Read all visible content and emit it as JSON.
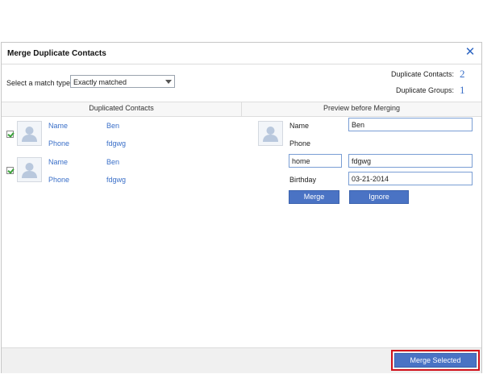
{
  "dialog": {
    "title": "Merge Duplicate Contacts",
    "close_icon": "close-icon"
  },
  "match": {
    "label": "Select a match type:",
    "selected": "Exactly matched"
  },
  "stats": {
    "duplicate_contacts_label": "Duplicate Contacts:",
    "duplicate_contacts_value": "2",
    "duplicate_groups_label": "Duplicate Groups:",
    "duplicate_groups_value": "1"
  },
  "columns": {
    "left": "Duplicated Contacts",
    "right": "Preview before Merging"
  },
  "contacts": [
    {
      "checked": true,
      "name_label": "Name",
      "name_value": "Ben",
      "phone_label": "Phone",
      "phone_value": "fdgwg"
    },
    {
      "checked": true,
      "name_label": "Name",
      "name_value": "Ben",
      "phone_label": "Phone",
      "phone_value": "fdgwg"
    }
  ],
  "preview": {
    "name_label": "Name",
    "name_value": "Ben",
    "phone_label": "Phone",
    "phone_type": "home",
    "phone_value": "fdgwg",
    "birthday_label": "Birthday",
    "birthday_value": "03-21-2014",
    "merge_button": "Merge",
    "ignore_button": "Ignore"
  },
  "footer": {
    "merge_selected_button": "Merge Selected"
  },
  "colors": {
    "accent": "#4a73c4",
    "link": "#3a6fc8",
    "highlight": "#d0111a"
  }
}
